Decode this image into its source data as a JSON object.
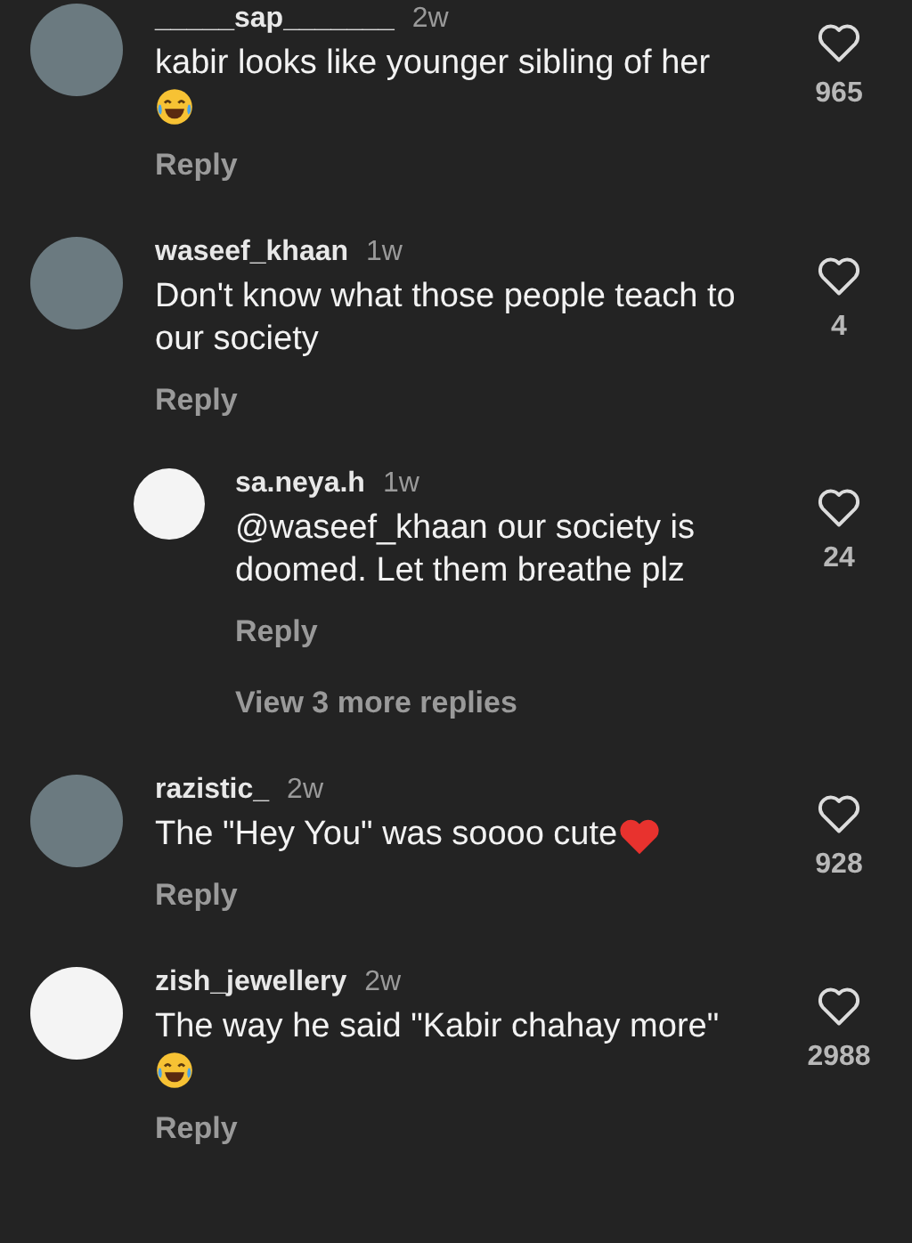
{
  "comments": [
    {
      "username": "_____sap_______",
      "time": "2w",
      "text": "kabir looks like younger sibling of her",
      "emoji": {
        "kind": "laugh"
      },
      "reply_label": "Reply",
      "likes": "965",
      "avatar": {
        "kind": "photo"
      }
    },
    {
      "username": "waseef_khaan",
      "time": "1w",
      "text": "Don't know what those people teach to our society",
      "reply_label": "Reply",
      "likes": "4",
      "avatar": {
        "kind": "photo"
      },
      "replies": [
        {
          "username": "sa.neya.h",
          "time": "1w",
          "text": "@waseef_khaan our society is doomed. Let them breathe plz",
          "reply_label": "Reply",
          "likes": "24",
          "avatar": {
            "kind": "logo"
          }
        }
      ],
      "view_more": "View 3 more replies"
    },
    {
      "username": "razistic_",
      "time": "2w",
      "text": "The \"Hey You\" was soooo cute",
      "emoji": {
        "kind": "heart"
      },
      "reply_label": "Reply",
      "likes": "928",
      "avatar": {
        "kind": "photo"
      }
    },
    {
      "username": "zish_jewellery",
      "time": "2w",
      "text": "The way he said \"Kabir chahay more\"",
      "emoji": {
        "kind": "laugh"
      },
      "reply_label": "Reply",
      "likes": "2988",
      "avatar": {
        "kind": "logo"
      }
    }
  ]
}
